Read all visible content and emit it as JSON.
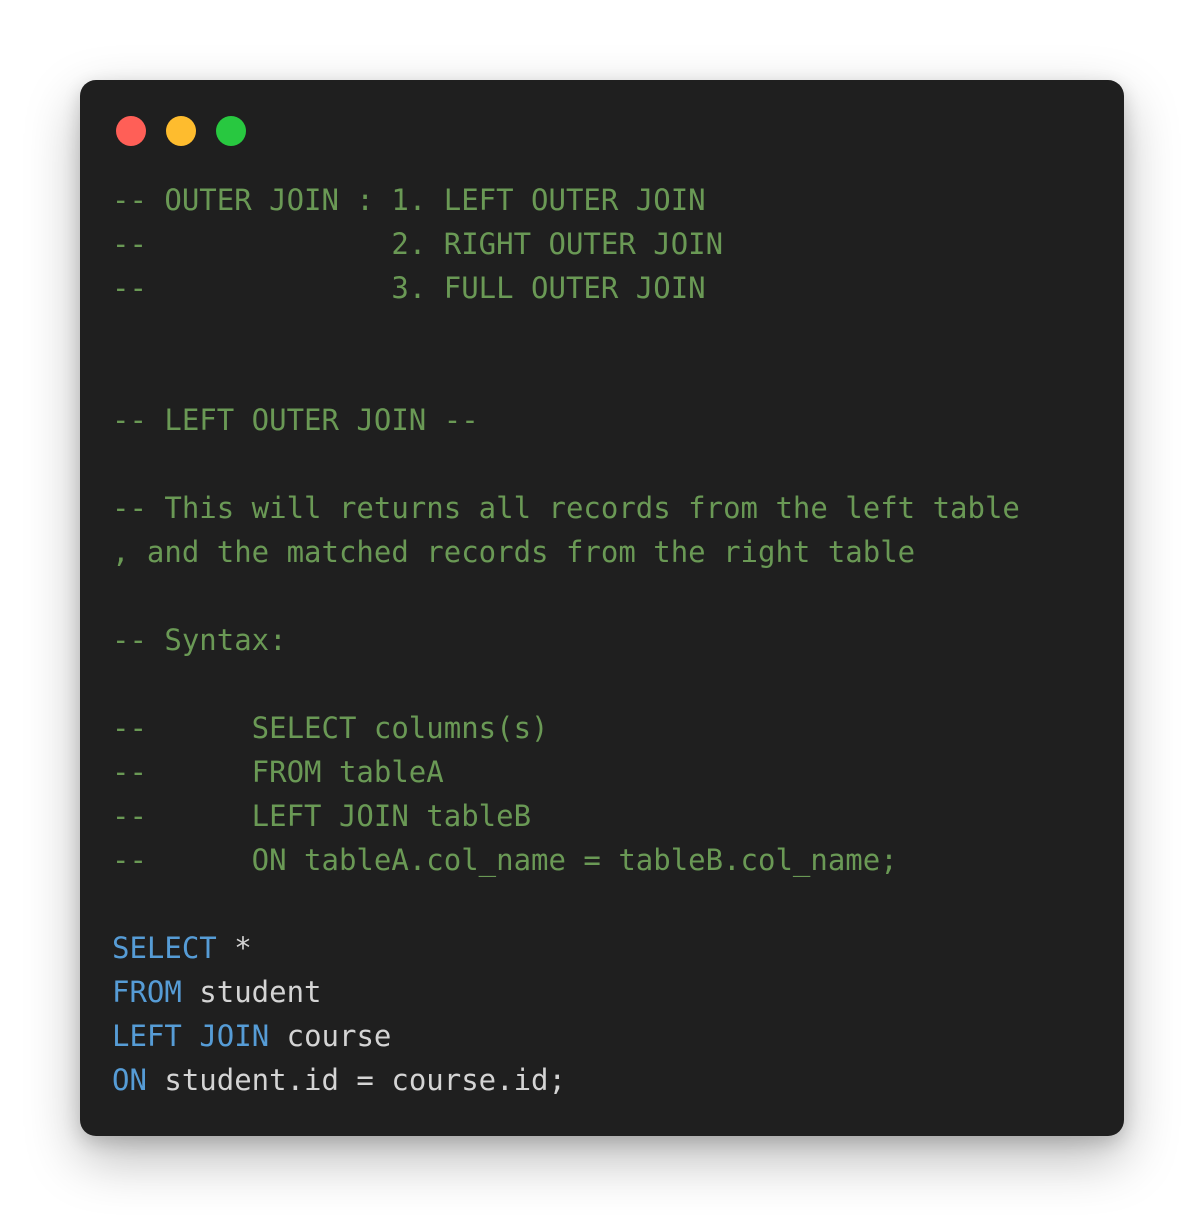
{
  "window": {
    "controls": [
      {
        "name": "close",
        "color": "#ff5f57"
      },
      {
        "name": "minimize",
        "color": "#febc2e"
      },
      {
        "name": "maximize",
        "color": "#28c840"
      }
    ]
  },
  "code": {
    "lines": [
      [
        {
          "cls": "comment",
          "text": "-- OUTER JOIN : 1. LEFT OUTER JOIN"
        }
      ],
      [
        {
          "cls": "comment",
          "text": "--              2. RIGHT OUTER JOIN"
        }
      ],
      [
        {
          "cls": "comment",
          "text": "--              3. FULL OUTER JOIN"
        }
      ],
      [],
      [],
      [
        {
          "cls": "comment",
          "text": "-- LEFT OUTER JOIN --"
        }
      ],
      [],
      [
        {
          "cls": "comment",
          "text": "-- This will returns all records from the left table"
        }
      ],
      [
        {
          "cls": "comment",
          "text": ", and the matched records from the right table"
        }
      ],
      [],
      [
        {
          "cls": "comment",
          "text": "-- Syntax:"
        }
      ],
      [],
      [
        {
          "cls": "comment",
          "text": "--      SELECT columns(s)"
        }
      ],
      [
        {
          "cls": "comment",
          "text": "--      FROM tableA"
        }
      ],
      [
        {
          "cls": "comment",
          "text": "--      LEFT JOIN tableB"
        }
      ],
      [
        {
          "cls": "comment",
          "text": "--      ON tableA.col_name = tableB.col_name;"
        }
      ],
      [],
      [
        {
          "cls": "kw",
          "text": "SELECT"
        },
        {
          "cls": "plain",
          "text": " *"
        }
      ],
      [
        {
          "cls": "kw",
          "text": "FROM"
        },
        {
          "cls": "plain",
          "text": " student"
        }
      ],
      [
        {
          "cls": "kw",
          "text": "LEFT"
        },
        {
          "cls": "plain",
          "text": " "
        },
        {
          "cls": "kw",
          "text": "JOIN"
        },
        {
          "cls": "plain",
          "text": " course"
        }
      ],
      [
        {
          "cls": "kw",
          "text": "ON"
        },
        {
          "cls": "plain",
          "text": " student.id = course.id;"
        }
      ]
    ]
  }
}
